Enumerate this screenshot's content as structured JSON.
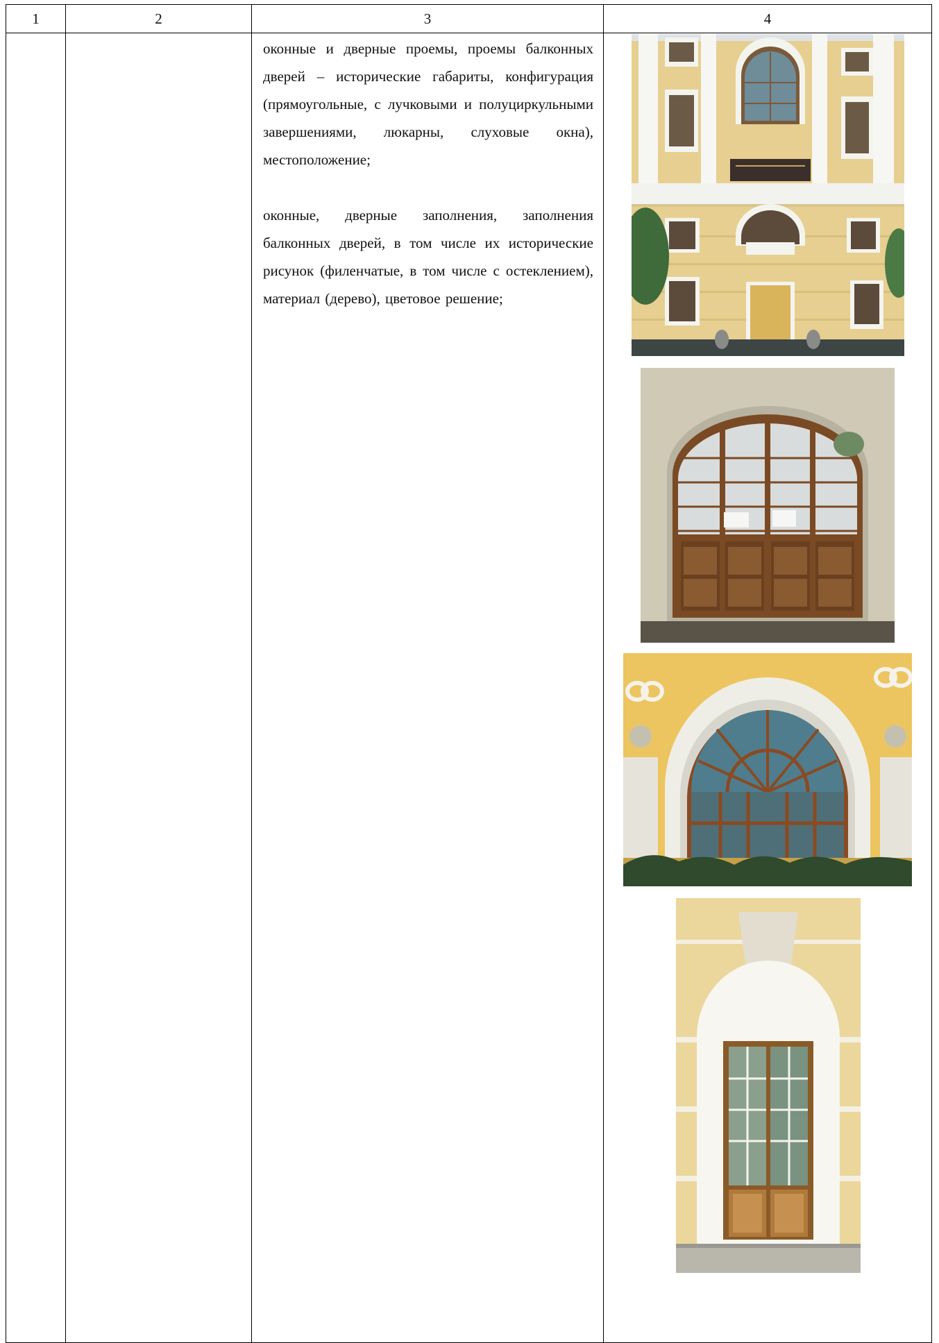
{
  "table": {
    "headers": [
      "1",
      "2",
      "3",
      "4"
    ],
    "row": {
      "col1": "",
      "col2": "",
      "col3_paragraphs": [
        "оконные и дверные проемы, проемы балконных дверей – исторические габариты, конфигурация (прямоугольные, с лучковыми и полуциркульными завершениями, люкарны, слуховые окна), местоположение;",
        "оконные, дверные заполнения, заполнения балконных дверей, в том числе их исторические рисунок (филенчатые, в том числе с остеклением), материал (дерево), цветовое решение;"
      ],
      "col4_photos": [
        {
          "name": "facade-photo",
          "subject": "facade"
        },
        {
          "name": "arched-door-photo",
          "subject": "arched door"
        },
        {
          "name": "semicircular-window-photo",
          "subject": "semicircular window"
        },
        {
          "name": "glazed-door-photo",
          "subject": "glazed door"
        }
      ]
    }
  },
  "colors": {
    "border": "#000000",
    "facade_yellow": "#e8cf8a",
    "trim_white": "#f4f4f0",
    "wood": "#8a5a2e",
    "glass": "#5d7f8f"
  }
}
